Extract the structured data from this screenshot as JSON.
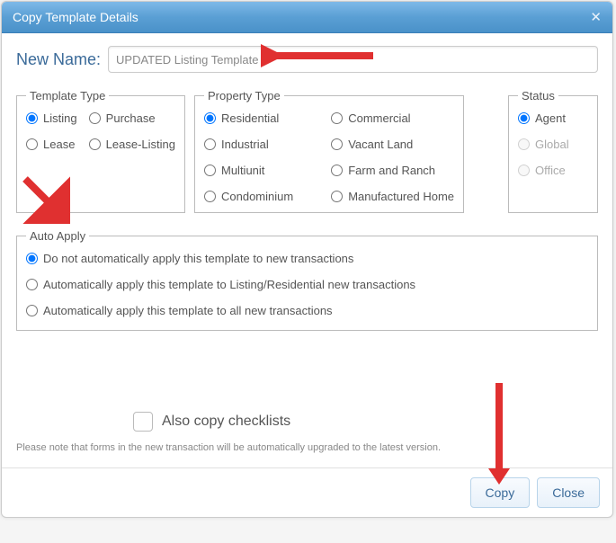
{
  "dialog": {
    "title": "Copy Template Details"
  },
  "name": {
    "label": "New Name:",
    "value": "UPDATED Listing Template"
  },
  "templateType": {
    "legend": "Template Type",
    "options": [
      {
        "label": "Listing",
        "checked": true
      },
      {
        "label": "Purchase",
        "checked": false
      },
      {
        "label": "Lease",
        "checked": false
      },
      {
        "label": "Lease-Listing",
        "checked": false
      }
    ]
  },
  "propertyType": {
    "legend": "Property Type",
    "options": [
      {
        "label": "Residential",
        "checked": true
      },
      {
        "label": "Commercial",
        "checked": false
      },
      {
        "label": "Industrial",
        "checked": false
      },
      {
        "label": "Vacant Land",
        "checked": false
      },
      {
        "label": "Multiunit",
        "checked": false
      },
      {
        "label": "Farm and Ranch",
        "checked": false
      },
      {
        "label": "Condominium",
        "checked": false
      },
      {
        "label": "Manufactured Home",
        "checked": false
      }
    ]
  },
  "status": {
    "legend": "Status",
    "options": [
      {
        "label": "Agent",
        "checked": true,
        "disabled": false
      },
      {
        "label": "Global",
        "checked": false,
        "disabled": true
      },
      {
        "label": "Office",
        "checked": false,
        "disabled": true
      }
    ]
  },
  "autoApply": {
    "legend": "Auto Apply",
    "options": [
      {
        "label": "Do not automatically apply this template to new transactions",
        "checked": true
      },
      {
        "label": "Automatically apply this template to Listing/Residential new transactions",
        "checked": false
      },
      {
        "label": "Automatically apply this template to all new transactions",
        "checked": false
      }
    ]
  },
  "checklist": {
    "label": "Also copy checklists",
    "checked": false
  },
  "note": "Please note that forms in the new transaction will be automatically upgraded to the latest version.",
  "buttons": {
    "copy": "Copy",
    "close": "Close"
  }
}
